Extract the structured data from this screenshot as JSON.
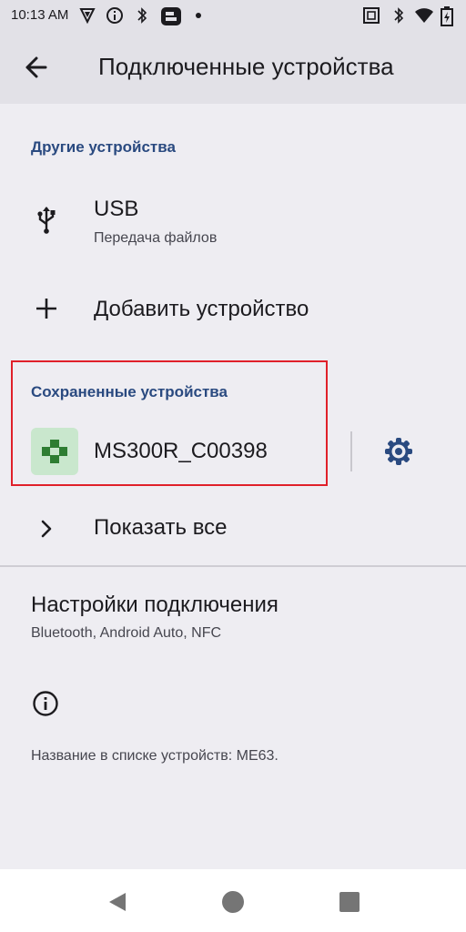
{
  "status_bar": {
    "time": "10:13 AM"
  },
  "app_bar": {
    "title": "Подключенные устройства"
  },
  "other_devices": {
    "header": "Другие устройства",
    "usb": {
      "title": "USB",
      "subtitle": "Передача файлов"
    },
    "add_device": "Добавить устройство"
  },
  "saved_devices": {
    "header": "Сохраненные устройства",
    "device_name": "MS300R_C00398",
    "show_all": "Показать все"
  },
  "connection_settings": {
    "title": "Настройки подключения",
    "subtitle": "Bluetooth, Android Auto, NFC"
  },
  "footer": {
    "device_name_text": "Название в списке устройств: ME63."
  },
  "colors": {
    "accent": "#2a4a80",
    "highlight": "#e0202a",
    "device_icon_bg": "#c9e7cd",
    "device_icon_fg": "#2e7d32"
  }
}
